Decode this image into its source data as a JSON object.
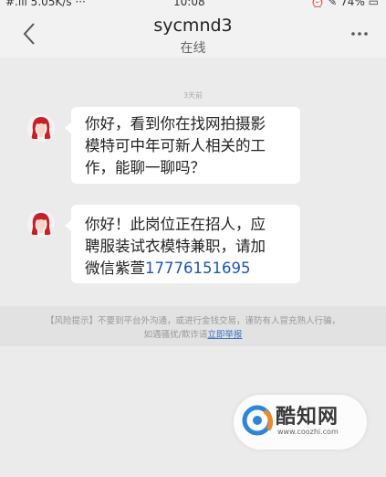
{
  "status_bar": {
    "left": "#.ill 5.05K/s ···",
    "time": "10:08",
    "right": "⏰ ✎ 74% ▭"
  },
  "header": {
    "title": "sycmnd3",
    "subtitle": "在线"
  },
  "timestamp": "3天前",
  "messages": [
    {
      "sender": "received",
      "lines": [
        "你好，看到你在找网拍摄影",
        "模特可中年可新人相关的工",
        "作，能聊一聊吗？"
      ]
    },
    {
      "sender": "received",
      "lines": [
        "你好！此岗位正在招人，应",
        "聘服装试衣模特兼职，请加"
      ],
      "last_line_prefix": "微信紫萱",
      "phone": "17776151695"
    }
  ],
  "risk_notice": {
    "line1": "【风险提示】不要到平台外沟通，或进行金钱交易，谨防有人冒充熟人行骗，",
    "line2_prefix": "如遇骚扰/欺诈请",
    "report_link": "立即举报"
  },
  "watermark": {
    "name": "酷知网",
    "url": "www.coozhi.com"
  },
  "colors": {
    "background": "#ebebeb",
    "bubble": "#ffffff",
    "link": "#3a6fc2",
    "phone": "#1a55b5"
  }
}
